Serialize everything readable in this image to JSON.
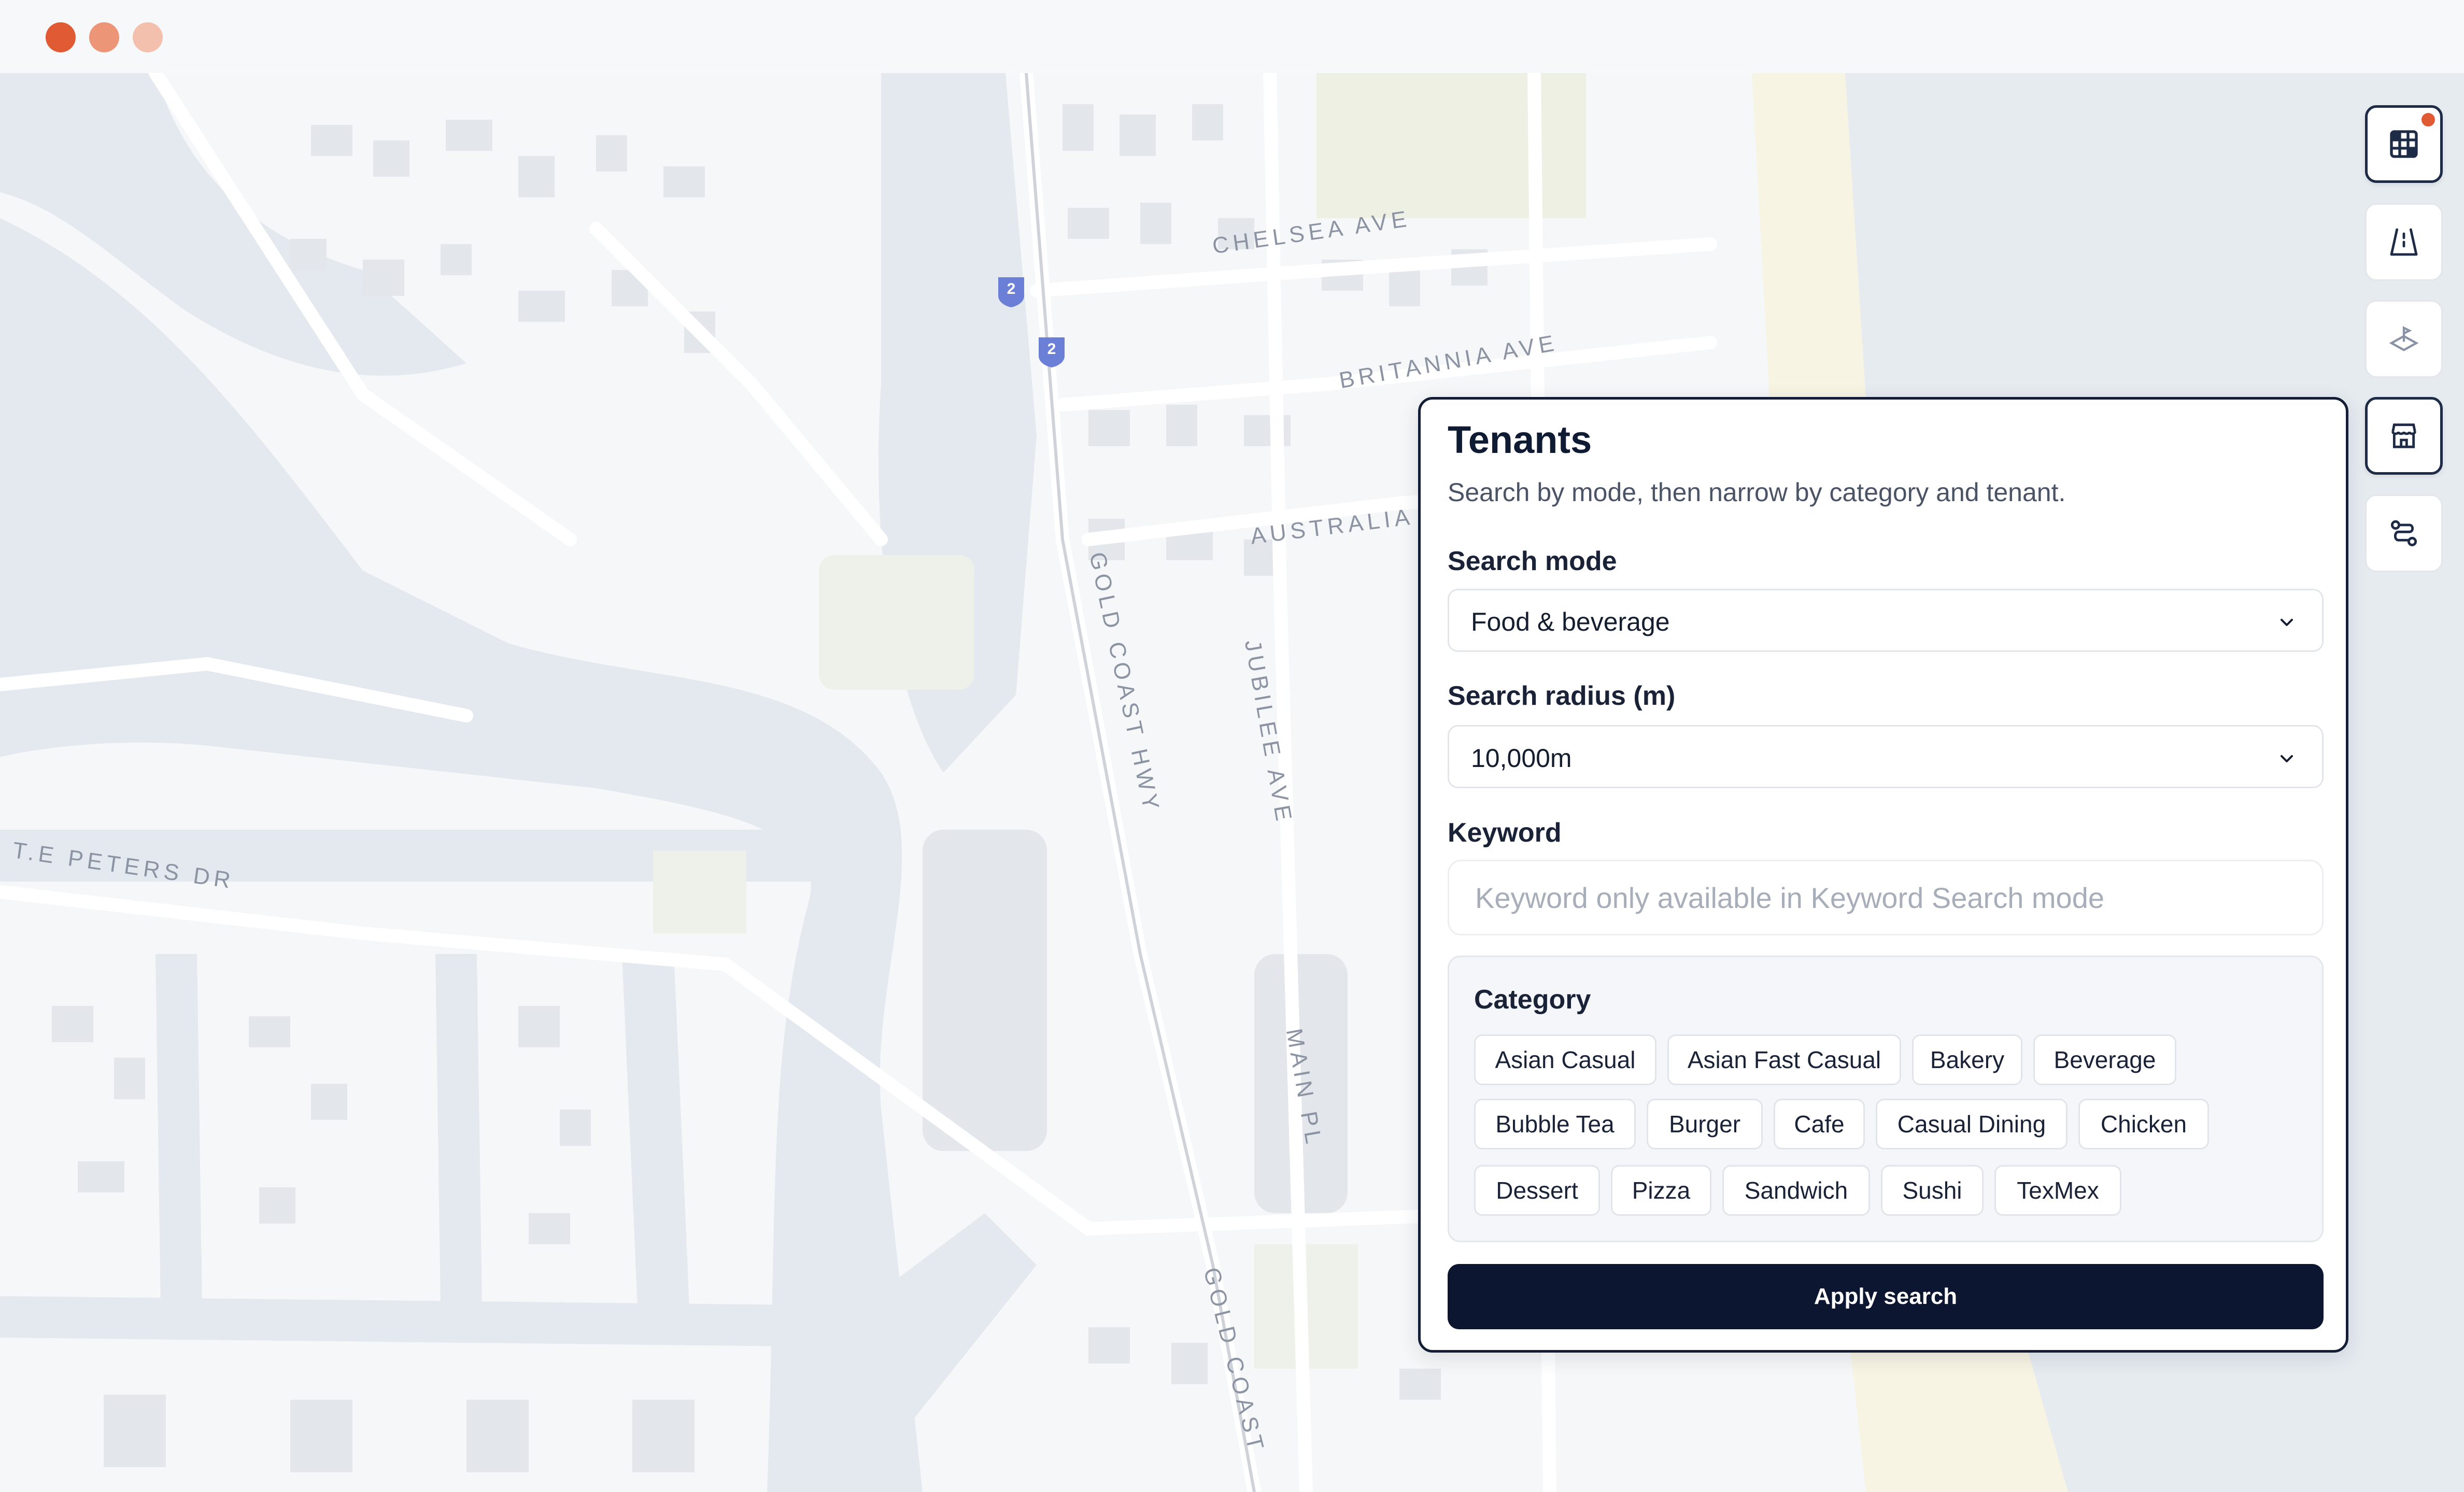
{
  "window": {
    "controls": [
      "close",
      "minimize",
      "maximize"
    ]
  },
  "map": {
    "streets": [
      "CHELSEA AVE",
      "BRITANNIA AVE",
      "AUSTRALIA",
      "GOLD COAST HWY",
      "JUBILEE AVE",
      "T.E PETERS DR",
      "MAIN PL",
      "GOLD COAST"
    ],
    "route_shield": "2"
  },
  "toolbar": {
    "items": [
      {
        "icon": "grid-icon",
        "active": true,
        "notification": true
      },
      {
        "icon": "road-icon",
        "active": false
      },
      {
        "icon": "map-pin-layer-icon",
        "active": false
      },
      {
        "icon": "store-icon",
        "active": true
      },
      {
        "icon": "route-icon",
        "active": false
      }
    ]
  },
  "panel": {
    "title": "Tenants",
    "subtitle": "Search by mode, then narrow by category and tenant.",
    "search_mode": {
      "label": "Search mode",
      "value": "Food & beverage"
    },
    "search_radius": {
      "label": "Search radius (m)",
      "value": "10,000m"
    },
    "keyword": {
      "label": "Keyword",
      "placeholder": "Keyword only available in Keyword Search mode",
      "value": ""
    },
    "category": {
      "label": "Category",
      "options": [
        "Asian Casual",
        "Asian Fast Casual",
        "Bakery",
        "Beverage",
        "Bubble Tea",
        "Burger",
        "Cafe",
        "Casual Dining",
        "Chicken",
        "Dessert",
        "Pizza",
        "Sandwich",
        "Sushi",
        "TexMex"
      ]
    },
    "apply_label": "Apply search"
  },
  "colors": {
    "accent": "#0d1630",
    "traffic_red": "#e05a33",
    "shield": "#6b7fd6",
    "water": "#e4e9ef",
    "land": "#f6f7f8"
  }
}
